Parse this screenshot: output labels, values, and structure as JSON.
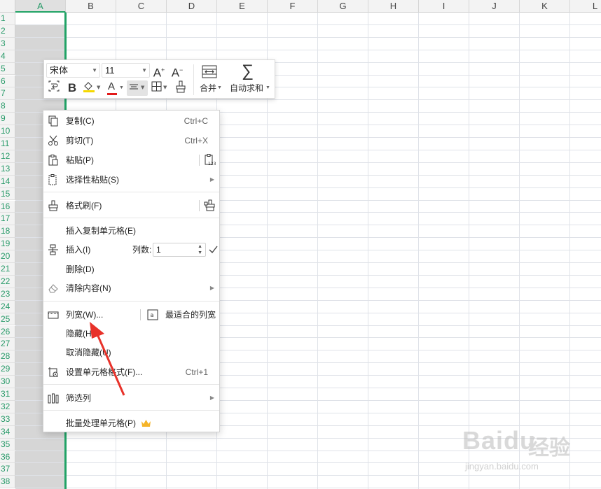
{
  "sheet": {
    "columns": [
      "A",
      "B",
      "C",
      "D",
      "E",
      "F",
      "G",
      "H",
      "I",
      "J",
      "K",
      "L"
    ],
    "rows": [
      "1",
      "2",
      "3",
      "4",
      "5",
      "6",
      "7",
      "8",
      "9",
      "10",
      "11",
      "12",
      "13",
      "14",
      "15",
      "16",
      "17",
      "18",
      "19",
      "20",
      "21",
      "22",
      "23",
      "24",
      "25",
      "26",
      "27",
      "28",
      "29",
      "30",
      "31",
      "32",
      "33",
      "34",
      "35",
      "36",
      "37",
      "38"
    ],
    "selected_column": "A",
    "accent_color": "#21a366"
  },
  "toolbar": {
    "font_name": "宋体",
    "font_size": "11",
    "increase_font": "A",
    "decrease_font": "A",
    "merge_label": "合并",
    "autosum_label": "自动求和",
    "bold_label": "B",
    "font_color_label": "A"
  },
  "menu": {
    "copy": {
      "label": "复制(C)",
      "shortcut": "Ctrl+C"
    },
    "cut": {
      "label": "剪切(T)",
      "shortcut": "Ctrl+X"
    },
    "paste": {
      "label": "粘贴(P)"
    },
    "paste_special": {
      "label": "选择性粘贴(S)"
    },
    "format_painter": {
      "label": "格式刷(F)"
    },
    "insert_copied": {
      "label": "插入复制单元格(E)"
    },
    "insert": {
      "label": "插入(I)",
      "count_label": "列数:",
      "count_value": "1"
    },
    "delete": {
      "label": "删除(D)"
    },
    "clear": {
      "label": "清除内容(N)"
    },
    "col_width": {
      "label": "列宽(W)...",
      "autofit_label": "最适合的列宽"
    },
    "hide": {
      "label": "隐藏(H)"
    },
    "unhide": {
      "label": "取消隐藏(U)"
    },
    "format_cells": {
      "label": "设置单元格格式(F)...",
      "shortcut": "Ctrl+1"
    },
    "filter_col": {
      "label": "筛选列"
    },
    "batch": {
      "label": "批量处理单元格(P)"
    }
  },
  "watermark": {
    "brand": "Baidu",
    "cn": "经验",
    "url": "jingyan.baidu.com"
  },
  "annotation": {
    "arrow_color": "#e8322a"
  }
}
